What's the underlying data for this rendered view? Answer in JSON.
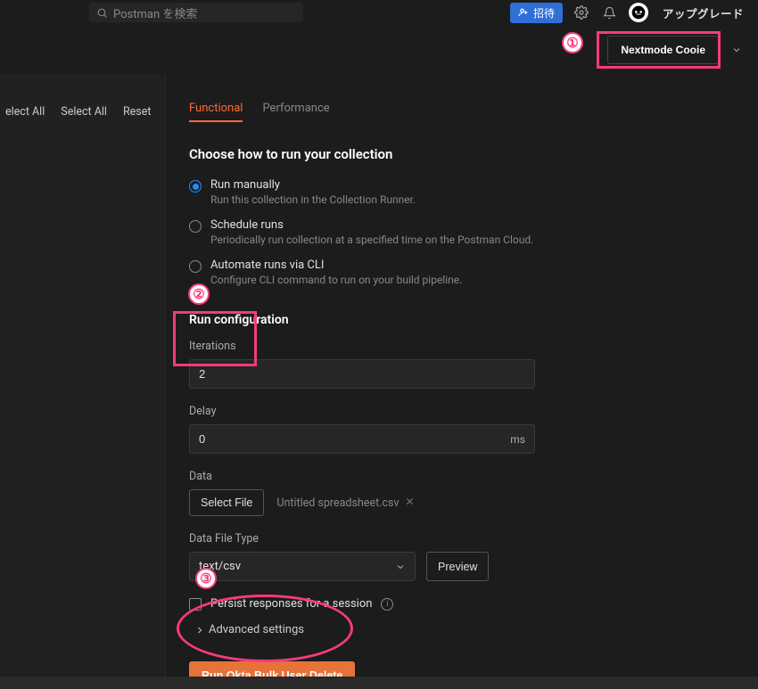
{
  "topbar": {
    "search_placeholder": "Postman を検索",
    "invite_label": "招待",
    "upgrade_label": "アップグレード"
  },
  "subheader": {
    "env_button": "Nextmode Cooie"
  },
  "left": {
    "select_all_1": "elect All",
    "select_all_2": "Select All",
    "reset": "Reset"
  },
  "tabs": {
    "functional": "Functional",
    "performance": "Performance"
  },
  "section": {
    "choose_title": "Choose how to run your collection",
    "run_config_title": "Run configuration"
  },
  "radios": {
    "manual_label": "Run manually",
    "manual_desc": "Run this collection in the Collection Runner.",
    "schedule_label": "Schedule runs",
    "schedule_desc": "Periodically run collection at a specified time on the Postman Cloud.",
    "cli_label": "Automate runs via CLI",
    "cli_desc": "Configure CLI command to run on your build pipeline."
  },
  "fields": {
    "iterations_label": "Iterations",
    "iterations_value": "2",
    "delay_label": "Delay",
    "delay_value": "0",
    "delay_unit": "ms",
    "data_label": "Data",
    "select_file": "Select File",
    "filename": "Untitled spreadsheet.csv",
    "filetype_label": "Data File Type",
    "filetype_value": "text/csv",
    "preview": "Preview",
    "persist": "Persist responses for a session",
    "advanced": "Advanced settings"
  },
  "run_button": "Run Okta Bulk User Delete",
  "annotations": {
    "one": "①",
    "two": "②",
    "three": "③"
  }
}
